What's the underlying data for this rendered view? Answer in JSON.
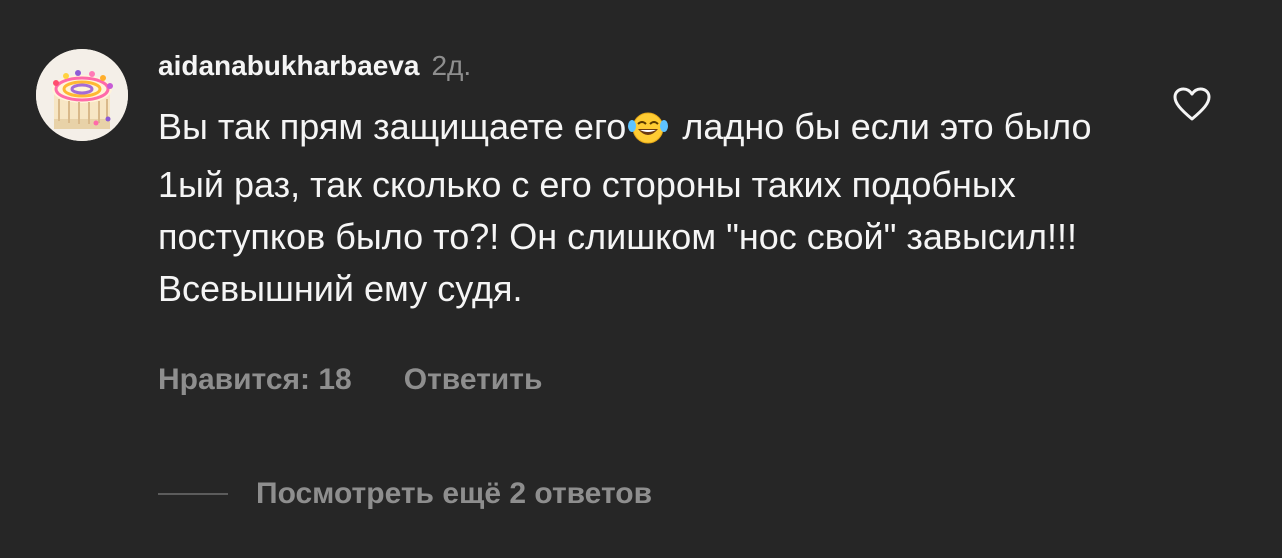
{
  "comment": {
    "username": "aidanabukharbaeva",
    "timestamp": "2д.",
    "text_part1": "Вы так прям защищаете его",
    "emoji_icon": "face-with-tears-of-joy-icon",
    "text_part2": " ладно бы если это было 1ый раз, так сколько с его стороны таких подобных поступков было то?! Он слишком \"нос свой\" завысил!!! Всевышний ему судя.",
    "likes_label": "Нравится: 18",
    "reply_label": "Ответить",
    "view_replies_label": "Посмотреть ещё 2 ответов",
    "like_icon": "heart-outline-icon"
  },
  "colors": {
    "background": "#262626",
    "primary_text": "#f5f5f5",
    "secondary_text": "#8e8e8e"
  }
}
